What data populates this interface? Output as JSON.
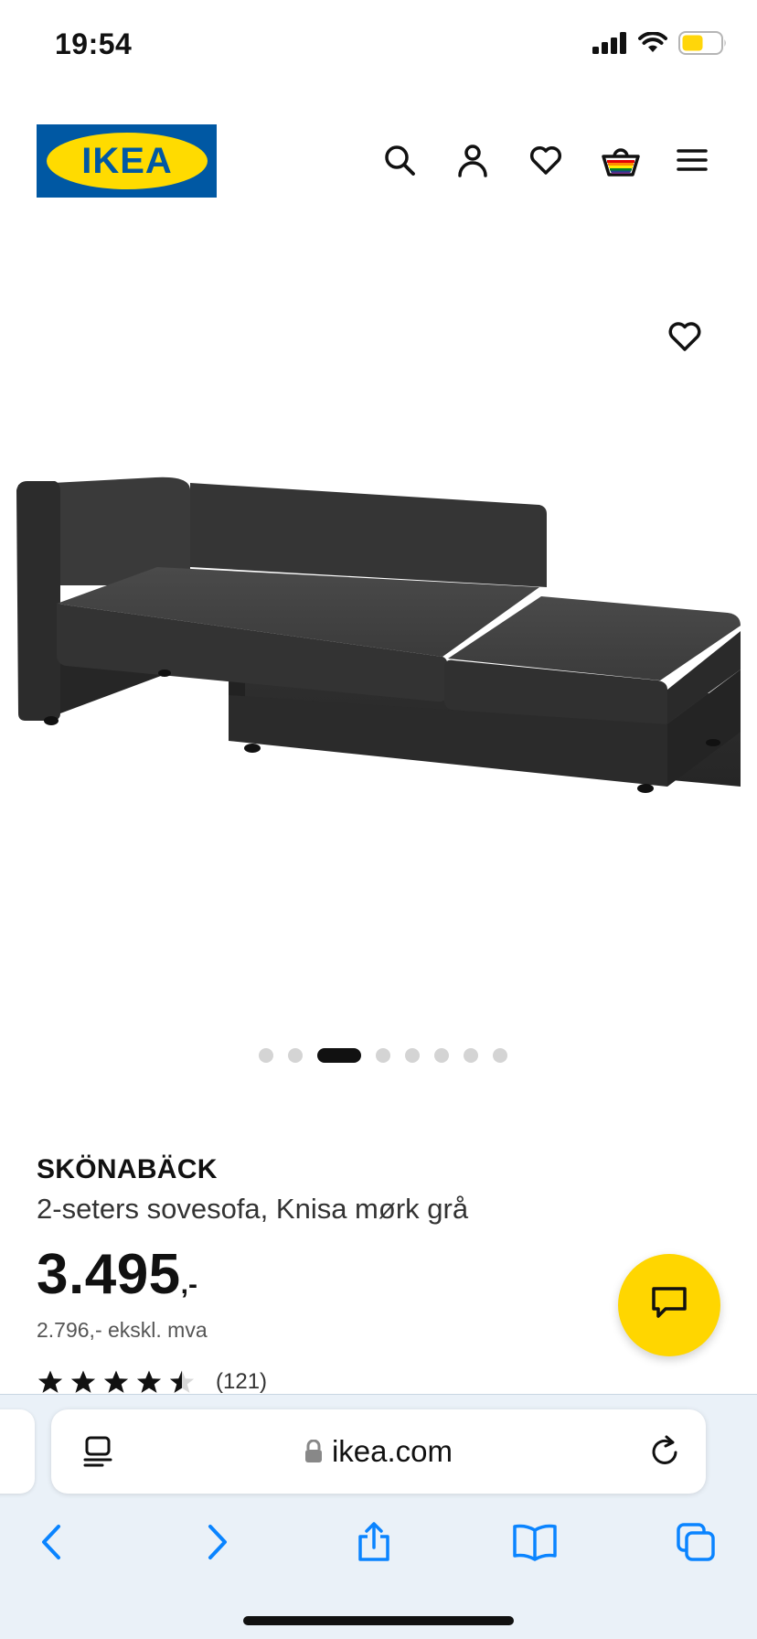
{
  "status": {
    "time": "19:54"
  },
  "header": {
    "logo_text": "IKEA"
  },
  "product": {
    "name": "SKÖNABÄCK",
    "description": "2-seters sovesofa, Knisa mørk grå",
    "price_main": "3.495",
    "price_suffix": ",-",
    "price_ex_vat": "2.796,- ekskl. mva",
    "rating_value": 4.5,
    "rating_max": 5,
    "rating_count": "(121)"
  },
  "carousel": {
    "total": 8,
    "active_index": 2
  },
  "browser": {
    "url": "ikea.com"
  },
  "colors": {
    "ikea_blue": "#0058a3",
    "ikea_yellow": "#ffdb00",
    "chat_button": "#ffd600",
    "safari_blue": "#0a84ff",
    "battery": "#ffd60a"
  },
  "icons": {
    "status": [
      "cellular-signal-icon",
      "wifi-icon",
      "battery-icon"
    ],
    "header": [
      "search-icon",
      "profile-icon",
      "heart-icon",
      "shopping-bag-icon",
      "menu-icon"
    ],
    "browser": [
      "reader-icon",
      "lock-icon",
      "reload-icon",
      "back-icon",
      "forward-icon",
      "share-icon",
      "bookmarks-icon",
      "tabs-icon"
    ]
  }
}
